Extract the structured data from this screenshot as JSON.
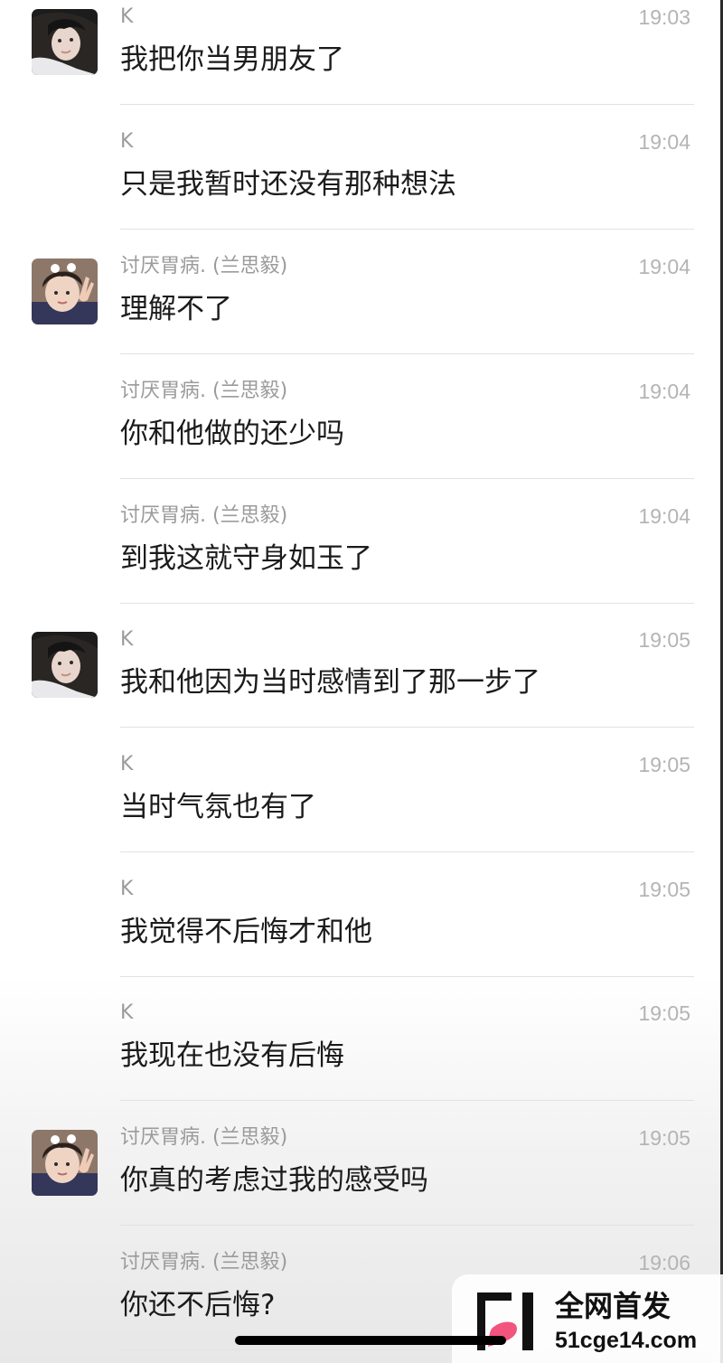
{
  "chat": {
    "messages": [
      {
        "sender": "K",
        "time": "19:03",
        "text": "我把你当男朋友了",
        "avatar": "avatar-k"
      },
      {
        "sender": "K",
        "time": "19:04",
        "text": "只是我暂时还没有那种想法",
        "avatar": null
      },
      {
        "sender": "讨厌胃病. (兰思毅)",
        "time": "19:04",
        "text": "理解不了",
        "avatar": "avatar-lan"
      },
      {
        "sender": "讨厌胃病. (兰思毅)",
        "time": "19:04",
        "text": "你和他做的还少吗",
        "avatar": null
      },
      {
        "sender": "讨厌胃病. (兰思毅)",
        "time": "19:04",
        "text": "到我这就守身如玉了",
        "avatar": null
      },
      {
        "sender": "K",
        "time": "19:05",
        "text": "我和他因为当时感情到了那一步了",
        "avatar": "avatar-k"
      },
      {
        "sender": "K",
        "time": "19:05",
        "text": "当时气氛也有了",
        "avatar": null
      },
      {
        "sender": "K",
        "time": "19:05",
        "text": "我觉得不后悔才和他",
        "avatar": null
      },
      {
        "sender": "K",
        "time": "19:05",
        "text": "我现在也没有后悔",
        "avatar": null
      },
      {
        "sender": "讨厌胃病. (兰思毅)",
        "time": "19:05",
        "text": "你真的考虑过我的感受吗",
        "avatar": "avatar-lan"
      },
      {
        "sender": "讨厌胃病. (兰思毅)",
        "time": "19:06",
        "text": "你还不后悔?",
        "avatar": null
      }
    ]
  },
  "watermark": {
    "title": "全网首发",
    "url": "51cge14.com"
  },
  "colors": {
    "sender": "#9b9b9b",
    "time": "#b4b4b4",
    "message_text": "#1b1b1b",
    "divider": "#e2e2e2",
    "watermark_pink": "#f2547d"
  }
}
